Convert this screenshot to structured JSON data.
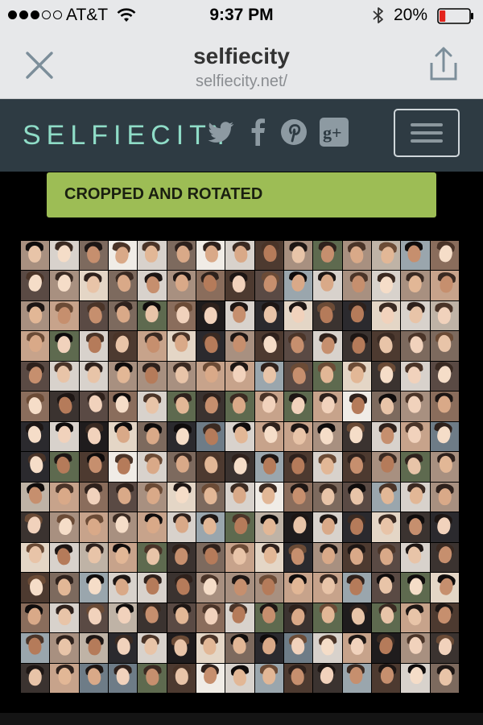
{
  "status_bar": {
    "carrier": "AT&T",
    "time": "9:37 PM",
    "battery": "20%",
    "signal_bars_filled": 3,
    "signal_bars_total": 5,
    "battery_level": 0.2,
    "icons": [
      "signal-dots-icon",
      "wifi-icon",
      "bluetooth-icon",
      "battery-icon"
    ]
  },
  "browser": {
    "title": "selfiecity",
    "url": "selfiecity.net/",
    "icons": [
      "close-icon",
      "share-icon"
    ]
  },
  "site_header": {
    "logo": "SELFIECITY",
    "social_icons": [
      "twitter-icon",
      "facebook-icon",
      "pinterest-icon",
      "google-plus-icon"
    ],
    "menu_icon": "hamburger-menu-icon"
  },
  "filter": {
    "label": "CROPPED AND ROTATED"
  },
  "grid": {
    "columns": 15,
    "rows": 15,
    "count": 225
  },
  "colors": {
    "status_bg": "#e7e8ea",
    "header_bg": "#2e3b43",
    "logo": "#8fdcc7",
    "banner": "#9dbd55",
    "battery_low": "#e3231c"
  }
}
